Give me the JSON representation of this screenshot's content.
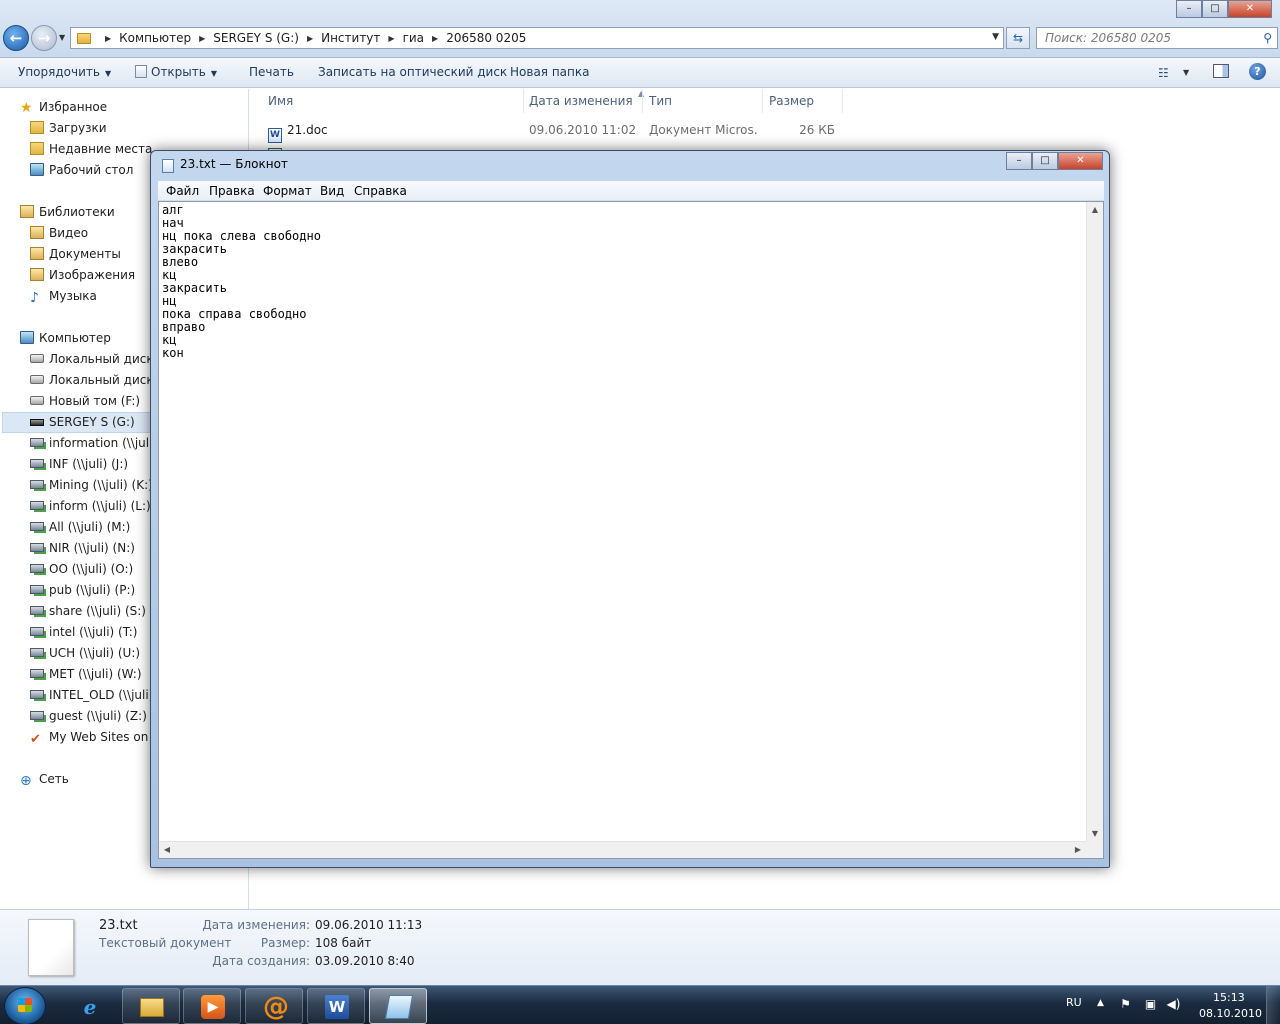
{
  "explorer": {
    "breadcrumb": [
      "Компьютер",
      "SERGEY S (G:)",
      "Институт",
      "гиа",
      "206580 0205"
    ],
    "search_placeholder": "Поиск: 206580 0205",
    "toolbar": {
      "organize": "Упорядочить",
      "open": "Открыть",
      "print": "Печать",
      "burn": "Записать на оптический диск",
      "new_folder": "Новая папка"
    },
    "nav": {
      "favorites": "Избранное",
      "downloads": "Загрузки",
      "recent": "Недавние места",
      "desktop": "Рабочий стол",
      "libraries": "Библиотеки",
      "videos": "Видео",
      "documents": "Документы",
      "pictures": "Изображения",
      "music": "Музыка",
      "computer": "Компьютер",
      "drives": [
        {
          "label": "Локальный диск (",
          "icon": "hdd-icon"
        },
        {
          "label": "Локальный диск (",
          "icon": "hdd-icon"
        },
        {
          "label": "Новый том (F:)",
          "icon": "hdd-icon"
        },
        {
          "label": "SERGEY S (G:)",
          "icon": "usb-drive-icon"
        },
        {
          "label": "information (\\\\juli)",
          "icon": "network-drive-icon"
        },
        {
          "label": "INF (\\\\juli) (J:)",
          "icon": "network-drive-icon"
        },
        {
          "label": "Mining (\\\\juli) (K:)",
          "icon": "network-drive-icon"
        },
        {
          "label": "inform (\\\\juli) (L:)",
          "icon": "network-drive-icon"
        },
        {
          "label": "All (\\\\juli) (M:)",
          "icon": "network-drive-icon"
        },
        {
          "label": "NIR (\\\\juli) (N:)",
          "icon": "network-drive-icon"
        },
        {
          "label": "OO (\\\\juli) (O:)",
          "icon": "network-drive-icon"
        },
        {
          "label": "pub (\\\\juli) (P:)",
          "icon": "network-drive-icon"
        },
        {
          "label": "share (\\\\juli) (S:)",
          "icon": "network-drive-icon"
        },
        {
          "label": "intel (\\\\juli) (T:)",
          "icon": "network-drive-icon"
        },
        {
          "label": "UCH (\\\\juli) (U:)",
          "icon": "network-drive-icon"
        },
        {
          "label": "MET (\\\\juli) (W:)",
          "icon": "network-drive-icon"
        },
        {
          "label": "INTEL_OLD (\\\\juli)",
          "icon": "network-drive-icon"
        },
        {
          "label": "guest (\\\\juli) (Z:)",
          "icon": "network-drive-icon"
        },
        {
          "label": "My Web Sites on M",
          "icon": "web-sites-icon"
        }
      ],
      "network": "Сеть"
    },
    "columns": {
      "name": "Имя",
      "date": "Дата изменения",
      "type": "Тип",
      "size": "Размер"
    },
    "files": [
      {
        "name": "21.doc",
        "date": "09.06.2010 11:02",
        "type": "Документ Micros...",
        "size": "26 КБ"
      }
    ],
    "details": {
      "filename": "23.txt",
      "filetype": "Текстовый документ",
      "modified_label": "Дата изменения:",
      "modified_value": "09.06.2010 11:13",
      "size_label": "Размер:",
      "size_value": "108 байт",
      "created_label": "Дата создания:",
      "created_value": "03.09.2010 8:40"
    }
  },
  "notepad": {
    "title": "23.txt — Блокнот",
    "menu": [
      "Файл",
      "Правка",
      "Формат",
      "Вид",
      "Справка"
    ],
    "content": "алг\nнач\nнц пока слева свободно\nзакрасить\nвлево\nкц\nзакрасить\nнц\nпока справа свободно\nвправо\nкц\nкон"
  },
  "taskbar": {
    "lang": "RU",
    "time": "15:13",
    "date": "08.10.2010"
  }
}
